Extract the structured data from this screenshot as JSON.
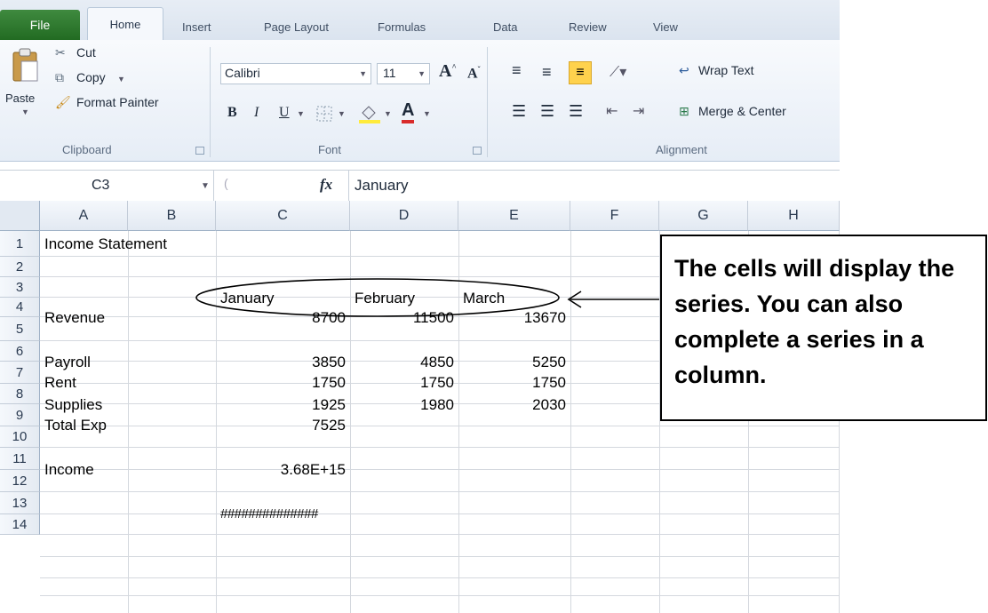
{
  "tabs": {
    "file": "File",
    "home": "Home",
    "insert": "Insert",
    "page_layout": "Page Layout",
    "formulas": "Formulas",
    "data": "Data",
    "review": "Review",
    "view": "View"
  },
  "ribbon": {
    "clipboard": {
      "paste": "Paste",
      "cut": "Cut",
      "copy": "Copy",
      "format_painter": "Format Painter",
      "label": "Clipboard"
    },
    "font": {
      "font_name": "Calibri",
      "font_size": "11",
      "label": "Font",
      "bold": "B",
      "italic": "I",
      "underline": "U"
    },
    "alignment": {
      "wrap_text": "Wrap Text",
      "merge_center": "Merge & Center",
      "label": "Alignment"
    }
  },
  "formula_bar": {
    "name_box": "C3",
    "fx": "fx",
    "value": "January"
  },
  "columns": [
    "A",
    "B",
    "C",
    "D",
    "E",
    "F",
    "G",
    "H"
  ],
  "rows": [
    "1",
    "2",
    "3",
    "4",
    "5",
    "6",
    "7",
    "8",
    "9",
    "10",
    "11",
    "12",
    "13",
    "14"
  ],
  "cells": {
    "A1": "Income Statement",
    "C3": "January",
    "D3": "February",
    "E3": "March",
    "A4": "Revenue",
    "C4": "8700",
    "D4": "11500",
    "E4": "13670",
    "A6": "Payroll",
    "C6": "3850",
    "D6": "4850",
    "E6": "5250",
    "A7": "Rent",
    "C7": "1750",
    "D7": "1750",
    "E7": "1750",
    "A8": "Supplies",
    "C8": "1925",
    "D8": "1980",
    "E8": "2030",
    "A9": "Total Exp",
    "C9": "7525",
    "A11": "Income",
    "C11": "3.68E+15",
    "C13": "##############"
  },
  "callout": {
    "text": "The cells will display the series. You can also complete a series in a column."
  },
  "colors": {
    "file_tab": "#2f7d2f",
    "highlight_fill": "#ffd24d",
    "font_color": "#d92b2b"
  }
}
